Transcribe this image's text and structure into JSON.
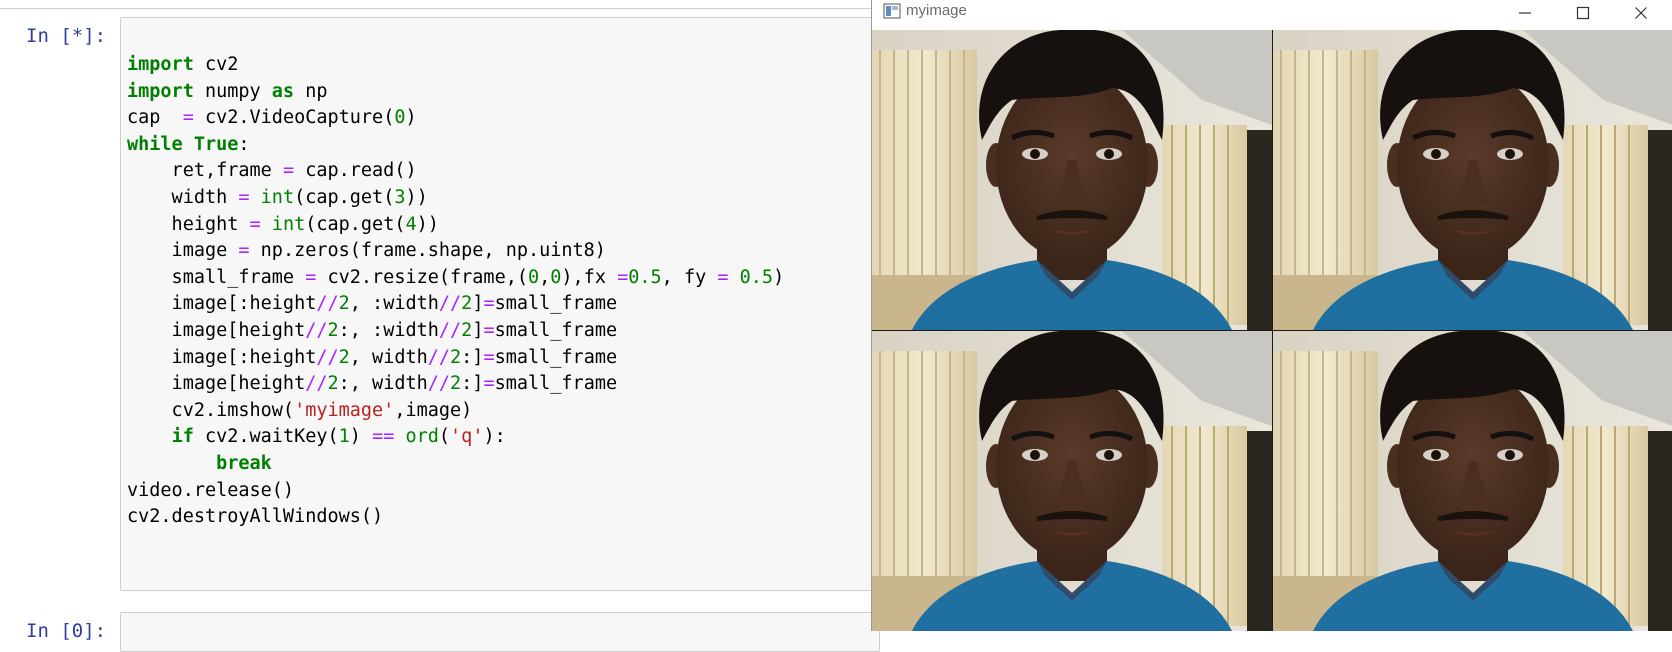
{
  "notebook": {
    "cell1_prompt": "In [*]:",
    "cell2_prompt": "In [0]:",
    "code_lines": [
      [
        {
          "t": "k",
          "v": "import"
        },
        {
          "t": "",
          "v": " cv2"
        }
      ],
      [
        {
          "t": "k",
          "v": "import"
        },
        {
          "t": "",
          "v": " numpy "
        },
        {
          "t": "k",
          "v": "as"
        },
        {
          "t": "",
          "v": " np"
        }
      ],
      [
        {
          "t": "",
          "v": "cap  "
        },
        {
          "t": "o",
          "v": "="
        },
        {
          "t": "",
          "v": " cv2.VideoCapture("
        },
        {
          "t": "n",
          "v": "0"
        },
        {
          "t": "",
          "v": ")"
        }
      ],
      [
        {
          "t": "k",
          "v": "while"
        },
        {
          "t": "",
          "v": " "
        },
        {
          "t": "k",
          "v": "True"
        },
        {
          "t": "",
          "v": ":"
        }
      ],
      [
        {
          "t": "",
          "v": "    ret,frame "
        },
        {
          "t": "o",
          "v": "="
        },
        {
          "t": "",
          "v": " cap.read()"
        }
      ],
      [
        {
          "t": "",
          "v": "    width "
        },
        {
          "t": "o",
          "v": "="
        },
        {
          "t": "",
          "v": " "
        },
        {
          "t": "b",
          "v": "int"
        },
        {
          "t": "",
          "v": "(cap.get("
        },
        {
          "t": "n",
          "v": "3"
        },
        {
          "t": "",
          "v": "))"
        }
      ],
      [
        {
          "t": "",
          "v": "    height "
        },
        {
          "t": "o",
          "v": "="
        },
        {
          "t": "",
          "v": " "
        },
        {
          "t": "b",
          "v": "int"
        },
        {
          "t": "",
          "v": "(cap.get("
        },
        {
          "t": "n",
          "v": "4"
        },
        {
          "t": "",
          "v": "))"
        }
      ],
      [
        {
          "t": "",
          "v": "    image "
        },
        {
          "t": "o",
          "v": "="
        },
        {
          "t": "",
          "v": " np.zeros(frame.shape, np.uint8)"
        }
      ],
      [
        {
          "t": "",
          "v": "    small_frame "
        },
        {
          "t": "o",
          "v": "="
        },
        {
          "t": "",
          "v": " cv2.resize(frame,("
        },
        {
          "t": "n",
          "v": "0"
        },
        {
          "t": "",
          "v": ","
        },
        {
          "t": "n",
          "v": "0"
        },
        {
          "t": "",
          "v": "),fx "
        },
        {
          "t": "o",
          "v": "="
        },
        {
          "t": "n",
          "v": "0.5"
        },
        {
          "t": "",
          "v": ", fy "
        },
        {
          "t": "o",
          "v": "="
        },
        {
          "t": "",
          "v": " "
        },
        {
          "t": "n",
          "v": "0.5"
        },
        {
          "t": "",
          "v": ")"
        }
      ],
      [
        {
          "t": "",
          "v": "    image[:height"
        },
        {
          "t": "o",
          "v": "//"
        },
        {
          "t": "n",
          "v": "2"
        },
        {
          "t": "",
          "v": ", :width"
        },
        {
          "t": "o",
          "v": "//"
        },
        {
          "t": "n",
          "v": "2"
        },
        {
          "t": "",
          "v": "]"
        },
        {
          "t": "o",
          "v": "="
        },
        {
          "t": "",
          "v": "small_frame"
        }
      ],
      [
        {
          "t": "",
          "v": "    image[height"
        },
        {
          "t": "o",
          "v": "//"
        },
        {
          "t": "n",
          "v": "2"
        },
        {
          "t": "",
          "v": ":, :width"
        },
        {
          "t": "o",
          "v": "//"
        },
        {
          "t": "n",
          "v": "2"
        },
        {
          "t": "",
          "v": "]"
        },
        {
          "t": "o",
          "v": "="
        },
        {
          "t": "",
          "v": "small_frame"
        }
      ],
      [
        {
          "t": "",
          "v": "    image[:height"
        },
        {
          "t": "o",
          "v": "//"
        },
        {
          "t": "n",
          "v": "2"
        },
        {
          "t": "",
          "v": ", width"
        },
        {
          "t": "o",
          "v": "//"
        },
        {
          "t": "n",
          "v": "2"
        },
        {
          "t": "",
          "v": ":]"
        },
        {
          "t": "o",
          "v": "="
        },
        {
          "t": "",
          "v": "small_frame"
        }
      ],
      [
        {
          "t": "",
          "v": "    image[height"
        },
        {
          "t": "o",
          "v": "//"
        },
        {
          "t": "n",
          "v": "2"
        },
        {
          "t": "",
          "v": ":, width"
        },
        {
          "t": "o",
          "v": "//"
        },
        {
          "t": "n",
          "v": "2"
        },
        {
          "t": "",
          "v": ":]"
        },
        {
          "t": "o",
          "v": "="
        },
        {
          "t": "",
          "v": "small_frame"
        }
      ],
      [
        {
          "t": "",
          "v": "    cv2.imshow("
        },
        {
          "t": "s",
          "v": "'myimage'"
        },
        {
          "t": "",
          "v": ",image)"
        }
      ],
      [
        {
          "t": "",
          "v": "    "
        },
        {
          "t": "k",
          "v": "if"
        },
        {
          "t": "",
          "v": " cv2.waitKey("
        },
        {
          "t": "n",
          "v": "1"
        },
        {
          "t": "",
          "v": ") "
        },
        {
          "t": "o",
          "v": "=="
        },
        {
          "t": "",
          "v": " "
        },
        {
          "t": "b",
          "v": "ord"
        },
        {
          "t": "",
          "v": "("
        },
        {
          "t": "s",
          "v": "'q'"
        },
        {
          "t": "",
          "v": "):"
        }
      ],
      [
        {
          "t": "",
          "v": "        "
        },
        {
          "t": "k",
          "v": "break"
        }
      ],
      [
        {
          "t": "",
          "v": "video.release()"
        }
      ],
      [
        {
          "t": "",
          "v": "cv2.destroyAllWindows()"
        }
      ]
    ]
  },
  "image_window": {
    "title": "myimage",
    "controls": [
      "minimize-icon",
      "maximize-icon",
      "close-icon"
    ],
    "tiles": 4
  },
  "colors": {
    "keyword": "#008000",
    "operator": "#aa22ff",
    "number": "#008000",
    "string": "#ba2121",
    "prompt": "#303f9f",
    "shirt": "#1f6fa0"
  }
}
